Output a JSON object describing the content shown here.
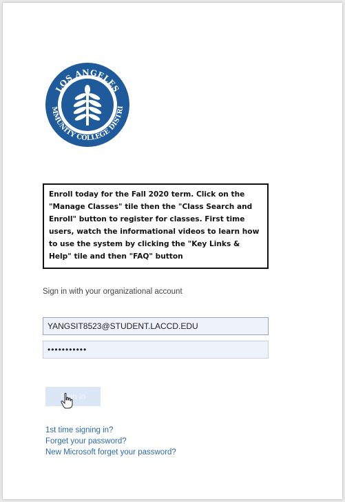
{
  "logo": {
    "name": "LOS ANGELES COMMUNITY COLLEGE DISTRICT",
    "arc_top": "LOS ANGELES",
    "arc_bottom": "COMMUNITY COLLEGE DISTRICT",
    "color": "#1f5b9b"
  },
  "notice": {
    "text": "Enroll today for the Fall 2020 term. Click on the \"Manage Classes\" tile then the \"Class Search and Enroll\" button to register for classes. First time users, watch the informational videos to learn how to use the system by clicking the \"Key Links & Help\" tile and then \"FAQ\" button"
  },
  "signin": {
    "label": "Sign in with your organizational account",
    "username_value": "YANGSIT8523@STUDENT.LACCD.EDU",
    "password_value": "•••••••••••",
    "button_label": "Sign in"
  },
  "links": {
    "first_time": "1st time signing in?",
    "forget": "Forget your password?",
    "new_forget": "New Microsoft forget your password?"
  },
  "colors": {
    "accent": "#2a6ab3",
    "input_bg": "#eef2fb",
    "button_bg": "#dbe7f7"
  }
}
